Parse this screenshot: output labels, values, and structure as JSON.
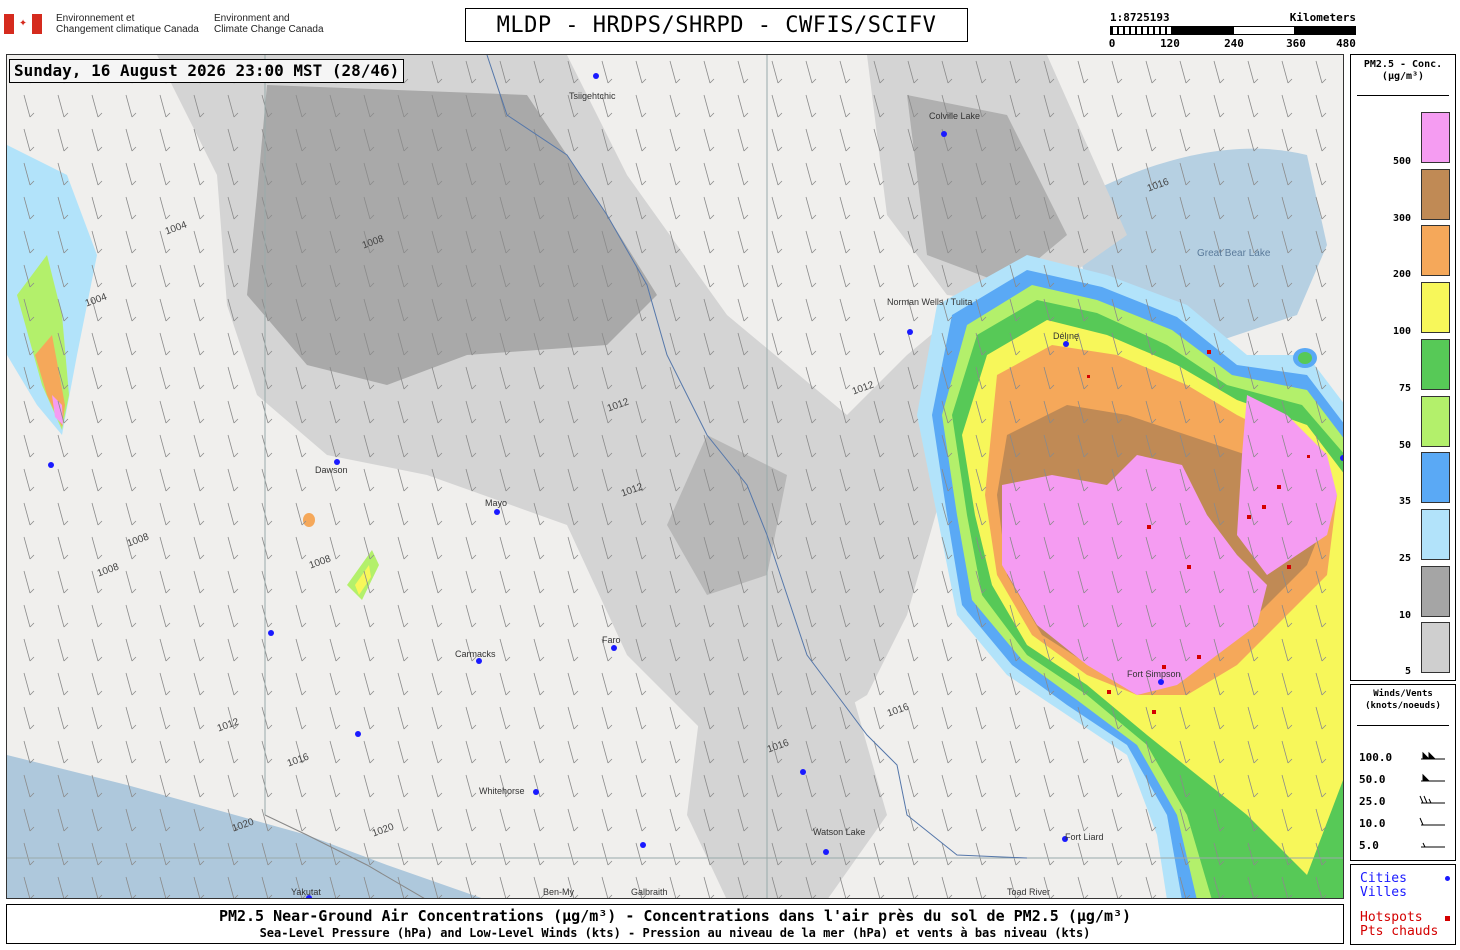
{
  "header": {
    "dept_fr": [
      "Environnement et",
      "Changement climatique Canada"
    ],
    "dept_en": [
      "Environment and",
      "Climate Change Canada"
    ],
    "title": "MLDP - HRDPS/SHRPD - CWFIS/SCIFV"
  },
  "scale": {
    "ratio": "1:8725193",
    "units": "Kilometers",
    "ticks": [
      "0",
      "120",
      "240",
      "360",
      "480"
    ]
  },
  "map": {
    "timestamp": "Sunday, 16 August 2026 23:00 MST (28/46)",
    "cities": [
      {
        "name": "Tsiigehtchic"
      },
      {
        "name": "Colville Lake"
      },
      {
        "name": "Norman Wells / Tulita"
      },
      {
        "name": "Délı̨nę"
      },
      {
        "name": "Dawson"
      },
      {
        "name": "Mayo"
      },
      {
        "name": "Carmacks"
      },
      {
        "name": "Faro"
      },
      {
        "name": "Whitehorse"
      },
      {
        "name": "Watson Lake"
      },
      {
        "name": "Fort Liard"
      },
      {
        "name": "Fort Simpson"
      },
      {
        "name": "Yakutat"
      },
      {
        "name": "Ben-My"
      },
      {
        "name": "Galbraith"
      },
      {
        "name": "Toad River"
      }
    ],
    "lakes": [
      "Great Bear Lake"
    ],
    "isobar_labels": [
      "1004",
      "1004",
      "1008",
      "1008",
      "1008",
      "1008",
      "1012",
      "1012",
      "1012",
      "1012",
      "1016",
      "1016",
      "1016",
      "1016",
      "1020",
      "1020"
    ]
  },
  "legend_pm": {
    "title": [
      "PM2.5 - Conc.",
      "(μg/m³)"
    ],
    "items": [
      {
        "label": "500",
        "color": "#f59cf2"
      },
      {
        "label": "300",
        "color": "#c08a55"
      },
      {
        "label": "200",
        "color": "#f5a85a"
      },
      {
        "label": "100",
        "color": "#f7f75a"
      },
      {
        "label": "75",
        "color": "#57c957"
      },
      {
        "label": "50",
        "color": "#b3f06b"
      },
      {
        "label": "35",
        "color": "#5aa9f5"
      },
      {
        "label": "25",
        "color": "#b2e3fa"
      },
      {
        "label": "10",
        "color": "#a5a5a5"
      },
      {
        "label": "5",
        "color": "#cfcfcf"
      }
    ]
  },
  "legend_wind": {
    "title": [
      "Winds/Vents",
      "(knots/noeuds)"
    ],
    "rows": [
      "100.0",
      "50.0",
      "25.0",
      "10.0",
      "5.0"
    ]
  },
  "legend_points": {
    "cities_en": "Cities",
    "cities_fr": "Villes",
    "hotspots_en": "Hotspots",
    "hotspots_fr": "Pts chauds",
    "city_color": "#1a1aff",
    "hotspot_color": "#d40000"
  },
  "footer": {
    "line1": "PM2.5 Near-Ground Air Concentrations (μg/m³) - Concentrations dans l'air près du sol de PM2.5 (μg/m³)",
    "line2": "Sea-Level Pressure (hPa) and Low-Level Winds (kts) - Pression au niveau de la mer (hPa) et vents à bas niveau (kts)"
  }
}
